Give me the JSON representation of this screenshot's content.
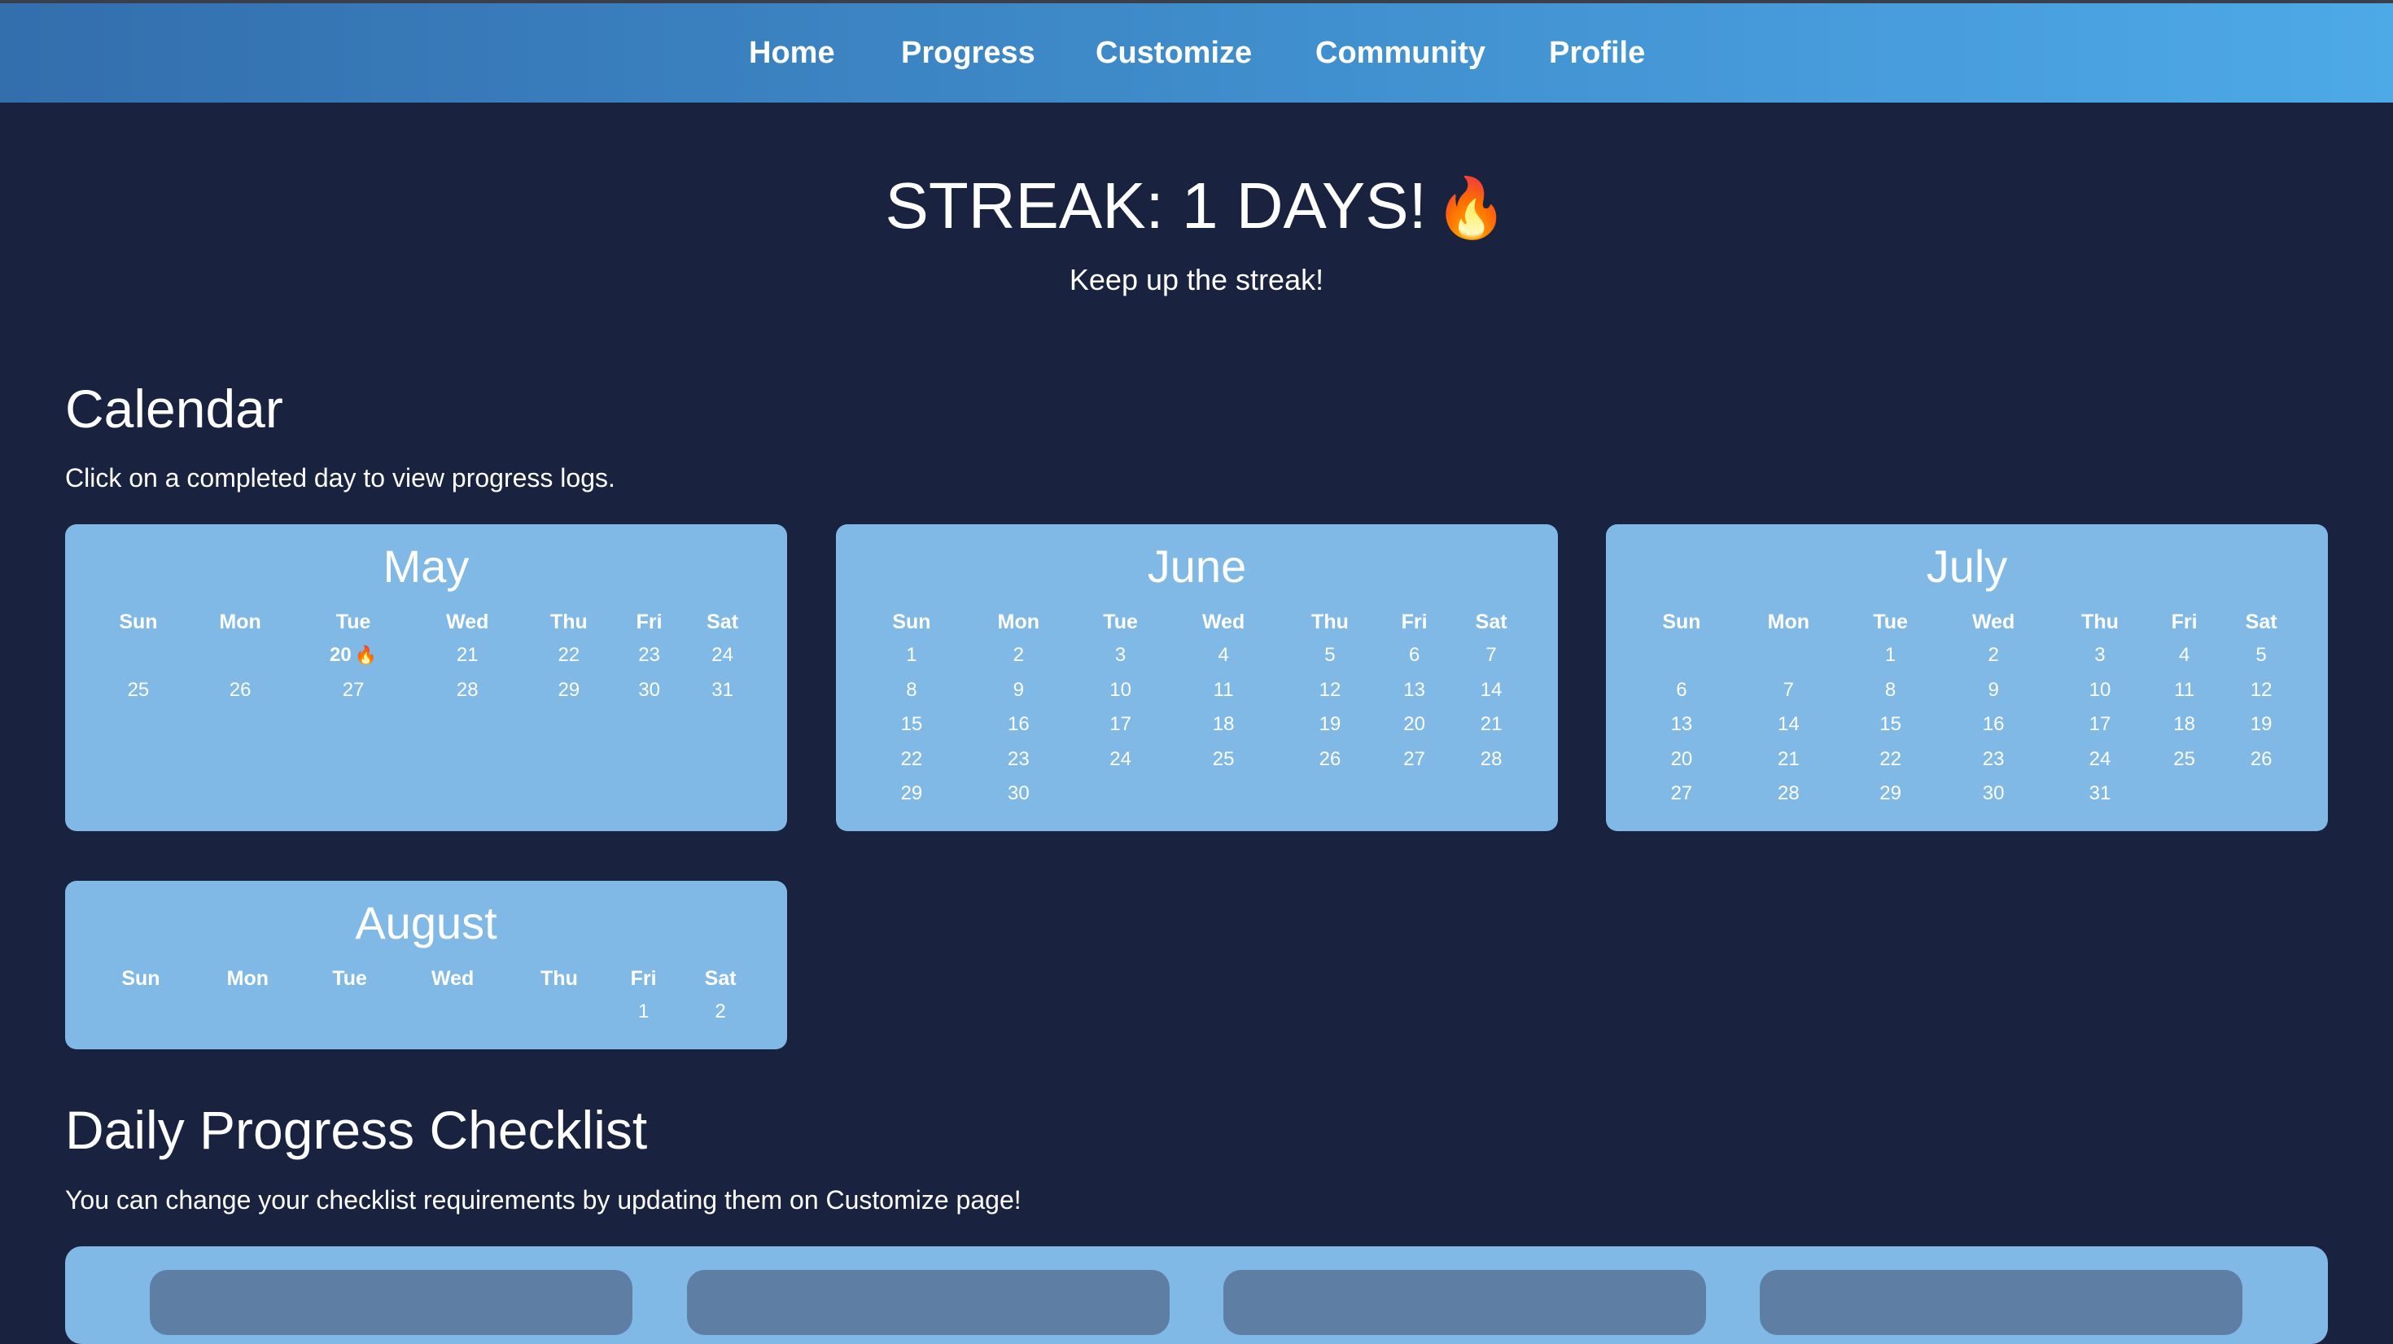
{
  "nav": {
    "items": [
      {
        "label": "Home"
      },
      {
        "label": "Progress"
      },
      {
        "label": "Customize"
      },
      {
        "label": "Community"
      },
      {
        "label": "Profile"
      }
    ]
  },
  "streak": {
    "title": "STREAK: 1 DAYS!",
    "flame": "🔥",
    "subtitle": "Keep up the streak!"
  },
  "calendar": {
    "title": "Calendar",
    "description": "Click on a completed day to view progress logs.",
    "weekdays": [
      "Sun",
      "Mon",
      "Tue",
      "Wed",
      "Thu",
      "Fri",
      "Sat"
    ],
    "completed_flame": "🔥",
    "months": [
      {
        "name": "May",
        "weeks": [
          [
            "",
            "",
            "20",
            "21",
            "22",
            "23",
            "24"
          ],
          [
            "25",
            "26",
            "27",
            "28",
            "29",
            "30",
            "31"
          ]
        ],
        "completed_days": [
          "20"
        ]
      },
      {
        "name": "June",
        "weeks": [
          [
            "1",
            "2",
            "3",
            "4",
            "5",
            "6",
            "7"
          ],
          [
            "8",
            "9",
            "10",
            "11",
            "12",
            "13",
            "14"
          ],
          [
            "15",
            "16",
            "17",
            "18",
            "19",
            "20",
            "21"
          ],
          [
            "22",
            "23",
            "24",
            "25",
            "26",
            "27",
            "28"
          ],
          [
            "29",
            "30",
            "",
            "",
            "",
            "",
            ""
          ]
        ],
        "completed_days": []
      },
      {
        "name": "July",
        "weeks": [
          [
            "",
            "",
            "1",
            "2",
            "3",
            "4",
            "5"
          ],
          [
            "6",
            "7",
            "8",
            "9",
            "10",
            "11",
            "12"
          ],
          [
            "13",
            "14",
            "15",
            "16",
            "17",
            "18",
            "19"
          ],
          [
            "20",
            "21",
            "22",
            "23",
            "24",
            "25",
            "26"
          ],
          [
            "27",
            "28",
            "29",
            "30",
            "31",
            "",
            ""
          ]
        ],
        "completed_days": []
      },
      {
        "name": "August",
        "weeks": [
          [
            "",
            "",
            "",
            "",
            "",
            "1",
            "2"
          ]
        ],
        "completed_days": []
      }
    ]
  },
  "checklist": {
    "title": "Daily Progress Checklist",
    "description": "You can change your checklist requirements by updating them on Customize page!"
  },
  "colors": {
    "background": "#19223f",
    "nav_gradient_start": "#336ead",
    "nav_gradient_end": "#4ea9e7",
    "card": "#80b9e5",
    "checklist_item": "#5e7ea3"
  }
}
